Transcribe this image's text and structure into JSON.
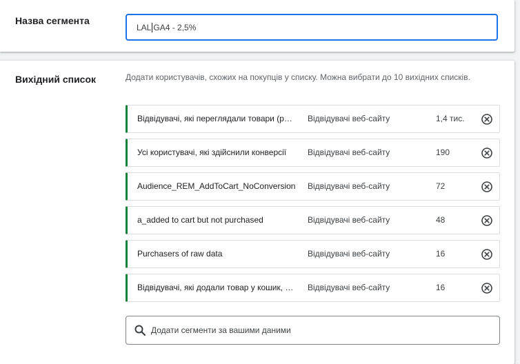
{
  "segment_name": {
    "label": "Назва сегмента",
    "value_before_caret": "LAL",
    "value_after_caret": " GA4 - 2,5%"
  },
  "source_list": {
    "label": "Вихідний список",
    "description": "Додати користувачів, схожих на покупців у списку. Можна вибрати до 10 вихідних списків.",
    "items": [
      {
        "name": "Відвідувачі, які переглядали товари (р…",
        "type": "Відвідувачі веб-сайту",
        "size": "1,4 тис."
      },
      {
        "name": "Усі користувачі, які здійснили конверсії",
        "type": "Відвідувачі веб-сайту",
        "size": "190"
      },
      {
        "name": "Audience_REM_AddToCart_NoConversion",
        "type": "Відвідувачі веб-сайту",
        "size": "72"
      },
      {
        "name": "a_added to cart but not purchased",
        "type": "Відвідувачі веб-сайту",
        "size": "48"
      },
      {
        "name": "Purchasers of raw data",
        "type": "Відвідувачі веб-сайту",
        "size": "16"
      },
      {
        "name": "Відвідувачі, які додали товар у кошик, …",
        "type": "Відвідувачі веб-сайту",
        "size": "16"
      }
    ],
    "remove_icon": "close-circle-icon",
    "add_placeholder": "Додати сегменти за вашими даними",
    "add_icon": "search-icon"
  },
  "colors": {
    "accent": "#1a73e8",
    "row_marker": "#188038",
    "border": "#dadce0",
    "background": "#f1f3f4"
  }
}
